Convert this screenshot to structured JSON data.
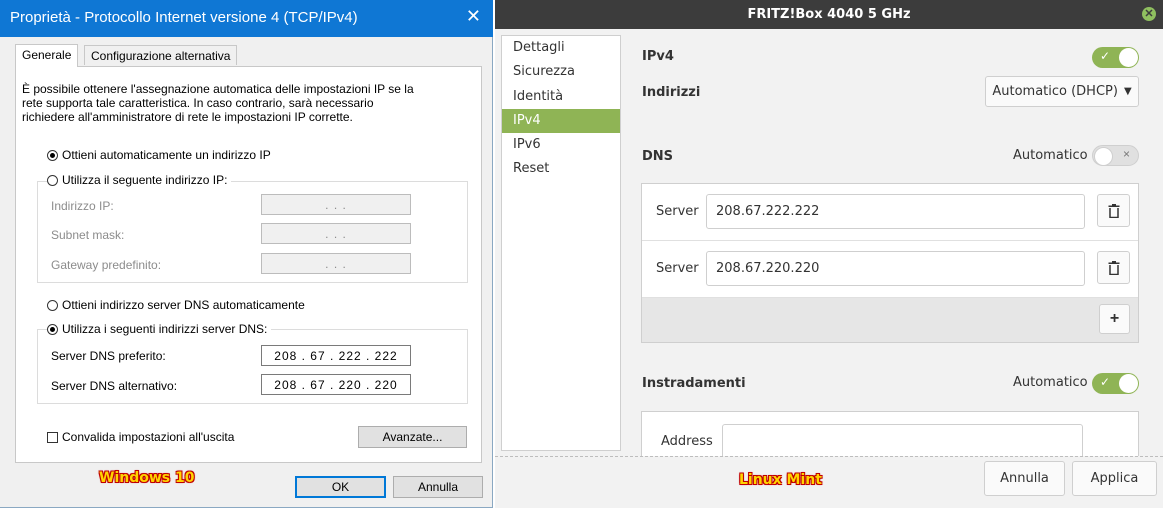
{
  "windows": {
    "title": "Proprietà - Protocollo Internet versione 4 (TCP/IPv4)",
    "close_glyph": "✕",
    "tabs": [
      "Generale",
      "Configurazione alternativa"
    ],
    "intro_lines": [
      "È possibile ottenere l'assegnazione automatica delle impostazioni IP se la",
      "rete supporta tale caratteristica. In caso contrario, sarà necessario",
      "richiedere all'amministratore di rete le impostazioni IP corrette."
    ],
    "ip_auto_label": "Ottieni automaticamente un indirizzo IP",
    "ip_manual_label": "Utilizza il seguente indirizzo IP:",
    "ip_fields": [
      {
        "label": "Indirizzo IP:",
        "value": ".   .   ."
      },
      {
        "label": "Subnet mask:",
        "value": ".   .   ."
      },
      {
        "label": "Gateway predefinito:",
        "value": ".   .   ."
      }
    ],
    "dns_auto_label": "Ottieni indirizzo server DNS automaticamente",
    "dns_manual_label": "Utilizza i seguenti indirizzi server DNS:",
    "dns_fields": [
      {
        "label": "Server DNS preferito:",
        "value": "208 . 67 . 222 . 222"
      },
      {
        "label": "Server DNS alternativo:",
        "value": "208 . 67 . 220 . 220"
      }
    ],
    "validate_label": "Convalida impostazioni all'uscita",
    "advanced_button": "Avanzate...",
    "ok_button": "OK",
    "cancel_button": "Annulla",
    "caption": "Windows 10"
  },
  "mint": {
    "title": "FRITZ!Box 4040 5 GHz",
    "close_glyph": "✕",
    "sidebar": [
      "Dettagli",
      "Sicurezza",
      "Identità",
      "IPv4",
      "IPv6",
      "Reset"
    ],
    "selected_sidebar": "IPv4",
    "ipv4_label": "IPv4",
    "addresses_label": "Indirizzi",
    "addresses_mode": "Automatico (DHCP)",
    "dns_label": "DNS",
    "automatic_label": "Automatico",
    "server_label": "Server",
    "servers": [
      "208.67.222.222",
      "208.67.220.220"
    ],
    "routes_label": "Instradamenti",
    "address_label": "Address",
    "address_value": "",
    "cancel_button": "Annulla",
    "apply_button": "Applica",
    "caption": "Linux Mint",
    "check_glyph": "✓",
    "x_glyph": "×",
    "plus_glyph": "+",
    "dropdown_arrow": "▼",
    "accent_color": "#8fb455"
  }
}
